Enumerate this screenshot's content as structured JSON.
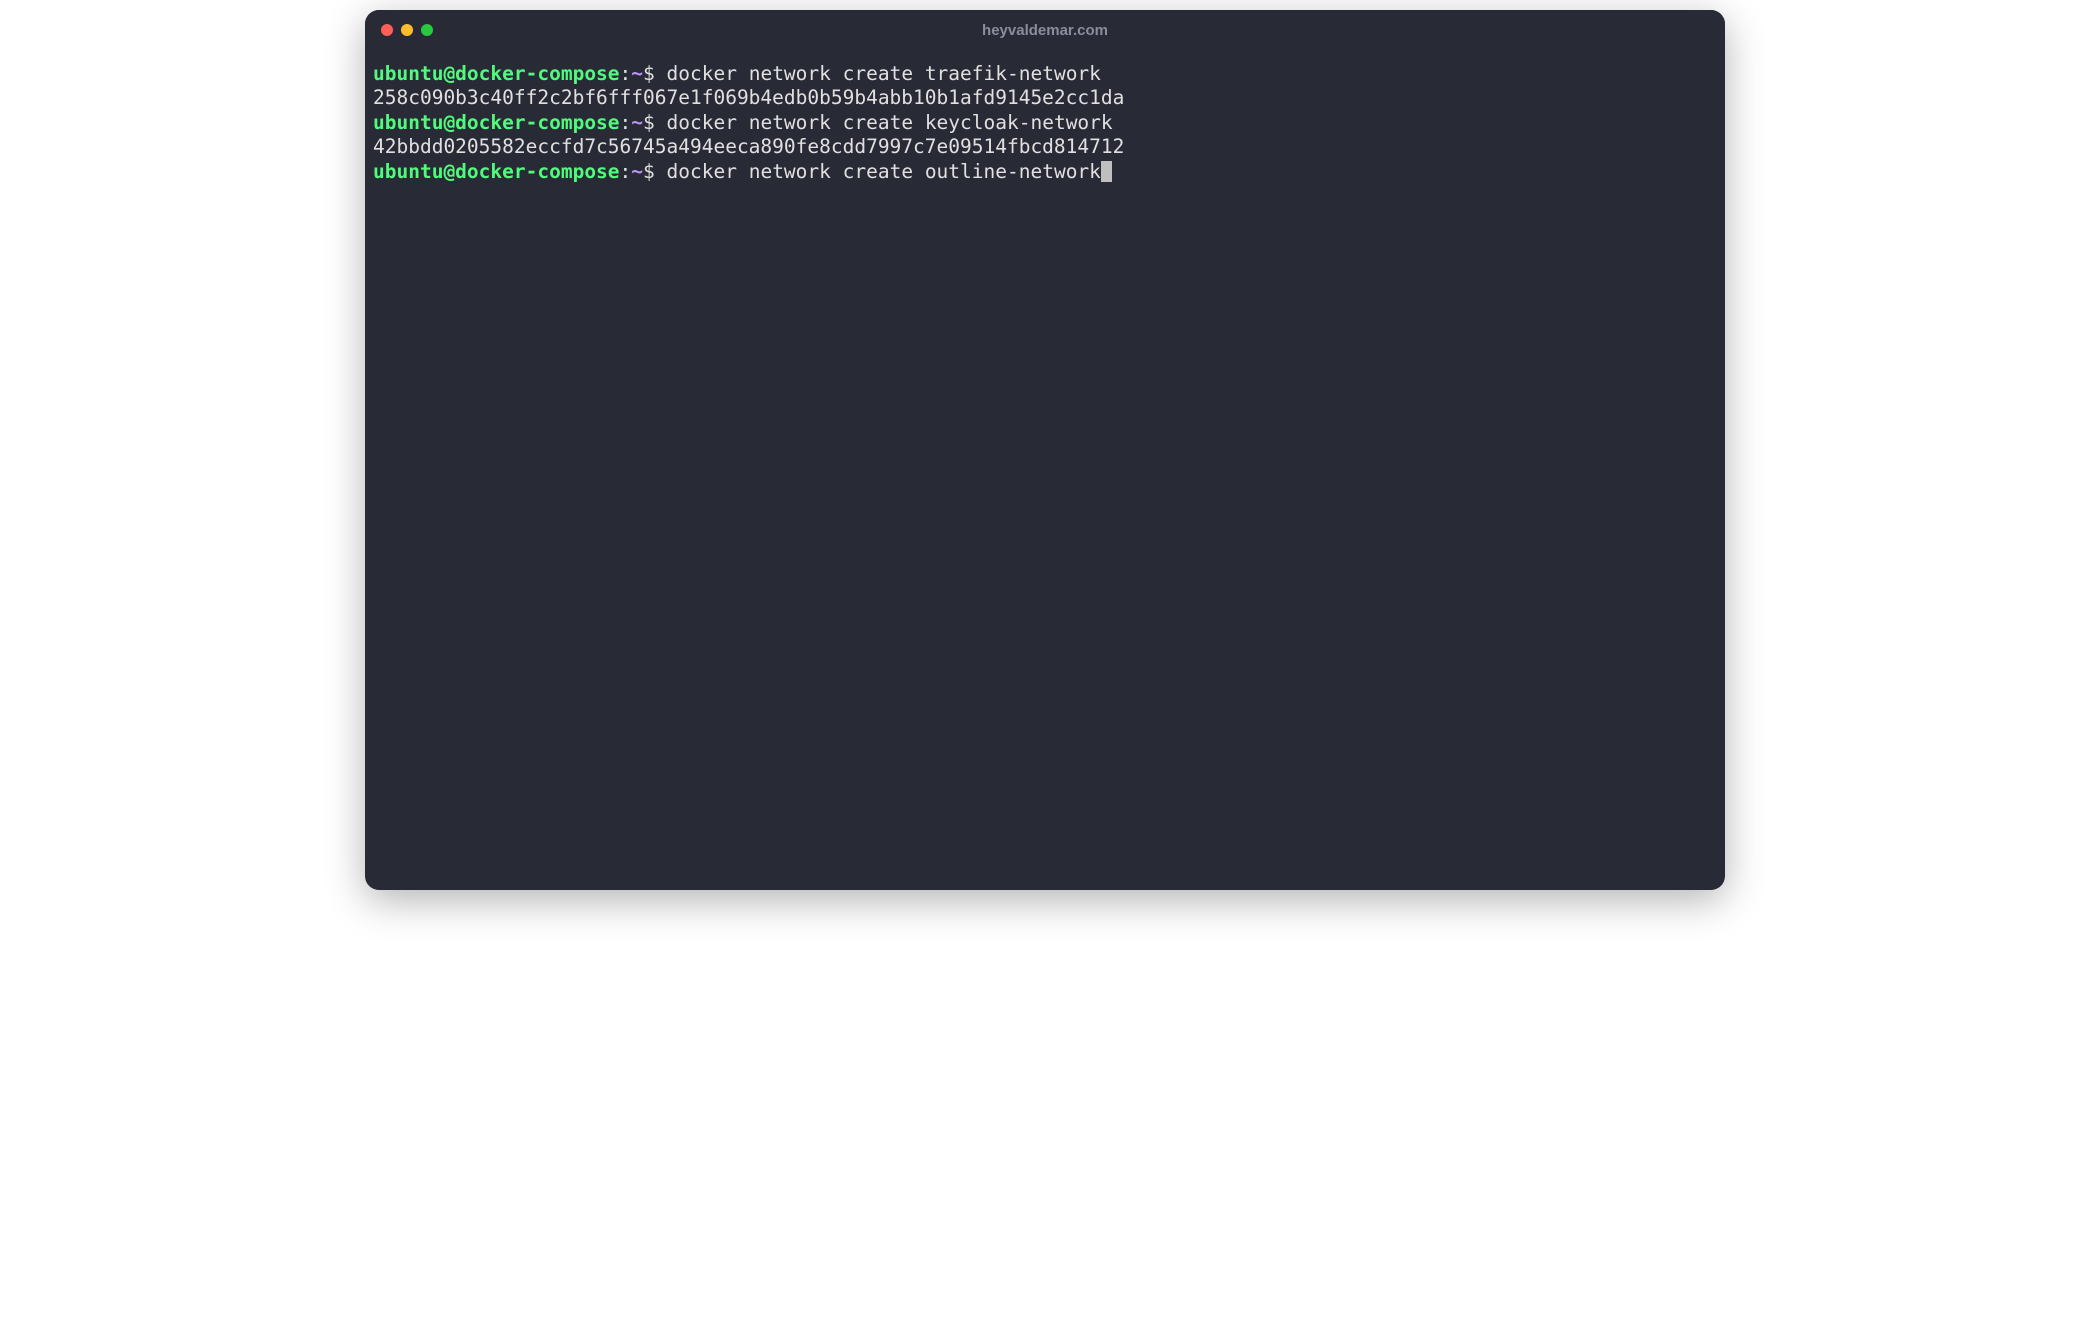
{
  "window": {
    "title": "heyvaldemar.com"
  },
  "prompt": {
    "user_host": "ubuntu@docker-compose",
    "colon": ":",
    "path": "~",
    "dollar": "$"
  },
  "lines": {
    "cmd1": " docker network create traefik-network",
    "out1": "258c090b3c40ff2c2bf6fff067e1f069b4edb0b59b4abb10b1afd9145e2cc1da",
    "cmd2": " docker network create keycloak-network",
    "out2": "42bbdd0205582eccfd7c56745a494eeca890fe8cdd7997c7e09514fbcd814712",
    "cmd3": " docker network create outline-network"
  }
}
